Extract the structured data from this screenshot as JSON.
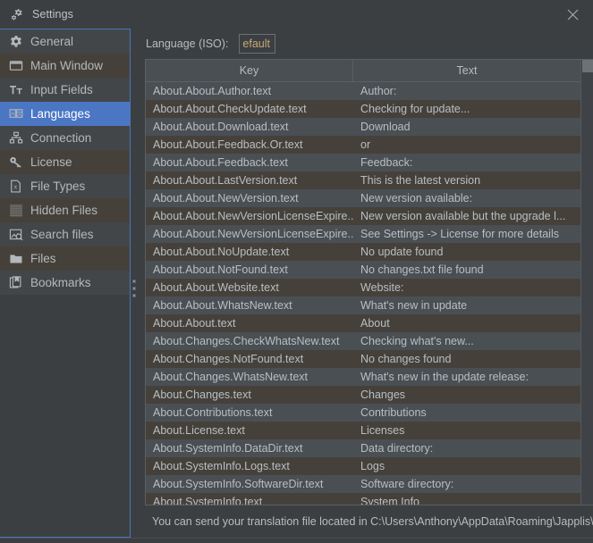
{
  "window": {
    "title": "Settings",
    "title_icon": "gear-icon",
    "close_icon": "close-icon"
  },
  "sidebar": {
    "items": [
      {
        "label": "General",
        "icon": "gear-icon",
        "selected": false
      },
      {
        "label": "Main Window",
        "icon": "window-icon",
        "selected": false
      },
      {
        "label": "Input Fields",
        "icon": "text-format-icon",
        "selected": false
      },
      {
        "label": "Languages",
        "icon": "language-icon",
        "selected": true
      },
      {
        "label": "Connection",
        "icon": "network-icon",
        "selected": false
      },
      {
        "label": "License",
        "icon": "key-icon",
        "selected": false
      },
      {
        "label": "File Types",
        "icon": "file-x-icon",
        "selected": false
      },
      {
        "label": "Hidden Files",
        "icon": "dotted-grid-icon",
        "selected": false
      },
      {
        "label": "Search files",
        "icon": "image-search-icon",
        "selected": false
      },
      {
        "label": "Files",
        "icon": "folder-icon",
        "selected": false
      },
      {
        "label": "Bookmarks",
        "icon": "bookmark-icon",
        "selected": false
      }
    ]
  },
  "main": {
    "language_label": "Language (ISO):",
    "language_value": "efault",
    "language_placeholder": "default",
    "table": {
      "columns": [
        "Key",
        "Text"
      ],
      "rows": [
        {
          "key": "About.About.Author.text",
          "text": "Author:"
        },
        {
          "key": "About.About.CheckUpdate.text",
          "text": "Checking for update..."
        },
        {
          "key": "About.About.Download.text",
          "text": "Download"
        },
        {
          "key": "About.About.Feedback.Or.text",
          "text": "or"
        },
        {
          "key": "About.About.Feedback.text",
          "text": "Feedback:"
        },
        {
          "key": "About.About.LastVersion.text",
          "text": "This is the latest version"
        },
        {
          "key": "About.About.NewVersion.text",
          "text": "New version available:"
        },
        {
          "key": "About.About.NewVersionLicenseExpire...",
          "text": "New version available but the upgrade l..."
        },
        {
          "key": "About.About.NewVersionLicenseExpire...",
          "text": "See Settings -> License for more details"
        },
        {
          "key": "About.About.NoUpdate.text",
          "text": "No update found"
        },
        {
          "key": "About.About.NotFound.text",
          "text": "No changes.txt file found"
        },
        {
          "key": "About.About.Website.text",
          "text": "Website:"
        },
        {
          "key": "About.About.WhatsNew.text",
          "text": "What's new in update"
        },
        {
          "key": "About.About.text",
          "text": "About"
        },
        {
          "key": "About.Changes.CheckWhatsNew.text",
          "text": "Checking what's new..."
        },
        {
          "key": "About.Changes.NotFound.text",
          "text": "No changes found"
        },
        {
          "key": "About.Changes.WhatsNew.text",
          "text": "What's new in the update release:"
        },
        {
          "key": "About.Changes.text",
          "text": "Changes"
        },
        {
          "key": "About.Contributions.text",
          "text": "Contributions"
        },
        {
          "key": "About.License.text",
          "text": "Licenses"
        },
        {
          "key": "About.SystemInfo.DataDir.text",
          "text": "Data directory:"
        },
        {
          "key": "About.SystemInfo.Logs.text",
          "text": "Logs"
        },
        {
          "key": "About.SystemInfo.SoftwareDir.text",
          "text": "Software directory:"
        },
        {
          "key": "About.SystemInfo.text",
          "text": "System Info"
        }
      ]
    }
  },
  "status": {
    "message": "You can send your translation file located in C:\\Users\\Anthony\\AppData\\Roaming\\Japplis\\Ant"
  },
  "colors": {
    "window_bg": "#3c3f41",
    "row_odd": "#4a4f54",
    "row_even": "#45413a",
    "selection": "#4a76c4",
    "accent_border": "#4a76b8",
    "text": "#b9bec3",
    "input_text": "#c9a87a"
  }
}
